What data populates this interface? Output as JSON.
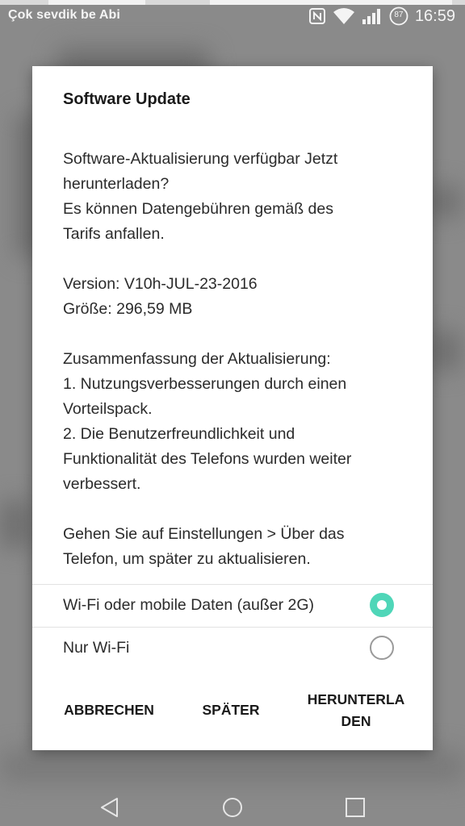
{
  "status_bar": {
    "notification_text": "Çok sevdik be Abi",
    "icons": [
      "nfc-icon",
      "wifi-icon",
      "signal-icon",
      "battery-icon"
    ],
    "battery_level": "87",
    "time": "16:59"
  },
  "dialog": {
    "title": "Software Update",
    "paragraphs": [
      [
        "Software-Aktualisierung verfügbar Jetzt",
        "herunterladen?",
        "Es können Datengebühren gemäß des",
        "Tarifs anfallen."
      ],
      [
        "Version: V10h-JUL-23-2016",
        "Größe: 296,59 MB"
      ],
      [
        "Zusammenfassung der Aktualisierung:",
        "1. Nutzungsverbesserungen durch einen",
        "Vorteilspack.",
        "2. Die Benutzerfreundlichkeit und",
        "Funktionalität des Telefons wurden weiter",
        "verbessert."
      ],
      [
        "Gehen Sie auf Einstellungen > Über das",
        "Telefon, um später zu aktualisieren."
      ]
    ],
    "options": [
      {
        "label": "Wi-Fi oder mobile Daten (außer 2G)",
        "selected": true
      },
      {
        "label": "Nur Wi-Fi",
        "selected": false
      }
    ],
    "buttons": {
      "cancel": "ABBRECHEN",
      "later": "SPÄTER",
      "download": "HERUNTERLADEN"
    }
  },
  "nav_bar": {
    "icons": [
      "back-icon",
      "home-icon",
      "recents-icon"
    ]
  },
  "colors": {
    "accent": "#4fd6b8",
    "dialog_bg": "#ffffff",
    "scrim": "#8a8a8a"
  }
}
